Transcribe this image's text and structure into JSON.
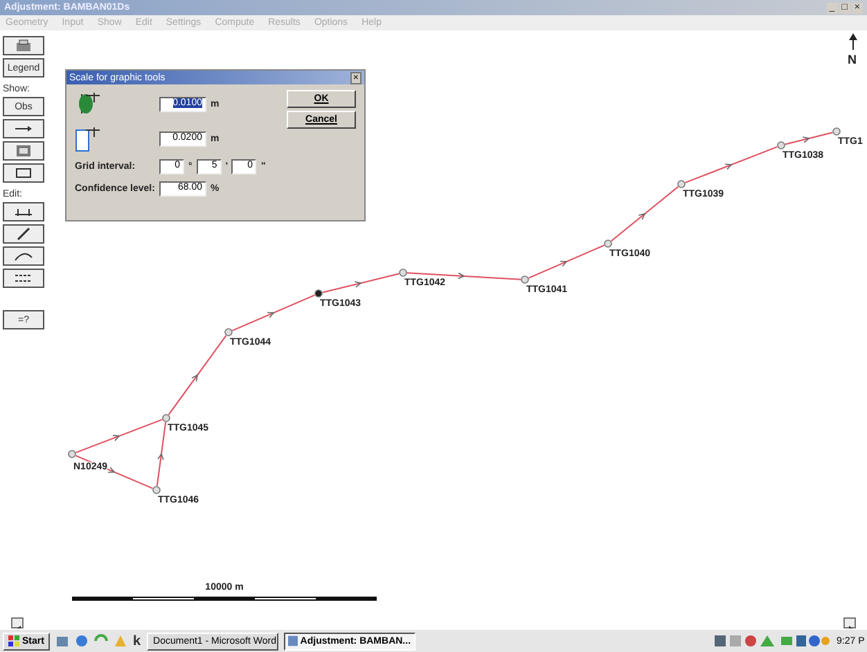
{
  "window": {
    "title": "Adjustment: BAMBAN01Ds",
    "controls": [
      "_",
      "□",
      "×"
    ]
  },
  "menu": [
    "Geometry",
    "Input",
    "Show",
    "Edit",
    "Settings",
    "Compute",
    "Results",
    "Options",
    "Help"
  ],
  "toolbar": [
    {
      "kind": "print"
    },
    {
      "kind": "text",
      "label": "Legend"
    },
    {
      "kind": "heading",
      "label": "Show:"
    },
    {
      "kind": "text",
      "label": "Obs"
    },
    {
      "kind": "arrow"
    },
    {
      "kind": "table"
    },
    {
      "kind": "frame"
    },
    {
      "kind": "heading",
      "label": "Edit:"
    },
    {
      "kind": "move"
    },
    {
      "kind": "pen"
    },
    {
      "kind": "curve"
    },
    {
      "kind": "dashes"
    },
    {
      "kind": "gap"
    },
    {
      "kind": "text",
      "label": "=?"
    }
  ],
  "dialog": {
    "title": "Scale for graphic tools",
    "ellipse_scale": {
      "value": "0.0100",
      "unit": "m",
      "selected": true
    },
    "rect_scale": {
      "value": "0.0200",
      "unit": "m",
      "selected": false
    },
    "grid_interval": {
      "label": "Grid interval:",
      "fields": [
        {
          "value": "0",
          "unit": "°"
        },
        {
          "value": "5",
          "unit": "'"
        },
        {
          "value": "0",
          "unit": "\""
        }
      ]
    },
    "confidence": {
      "label": "Confidence level:",
      "value": "68.00",
      "unit": "%"
    },
    "buttons": [
      "OK",
      "Cancel"
    ]
  },
  "network": {
    "stations": [
      {
        "name": "N10249",
        "selected": false
      },
      {
        "name": "TTG1046",
        "selected": false
      },
      {
        "name": "TTG1045",
        "selected": false
      },
      {
        "name": "TTG1044",
        "selected": false
      },
      {
        "name": "TTG1043",
        "selected": true
      },
      {
        "name": "TTG1042",
        "selected": false
      },
      {
        "name": "TTG1041",
        "selected": false
      },
      {
        "name": "TTG1040",
        "selected": false
      },
      {
        "name": "TTG1039",
        "selected": false
      },
      {
        "name": "TTG1038",
        "selected": false
      },
      {
        "name": "TTG1",
        "selected": false
      }
    ],
    "north_label": "N",
    "scale_label": "10000 m"
  },
  "taskbar": {
    "start": "Start",
    "quick_text": "k",
    "tasks": [
      {
        "label": "Document1 - Microsoft Word",
        "selected": false
      },
      {
        "label": "Adjustment: BAMBAN...",
        "selected": true
      }
    ],
    "clock": "9:27 P"
  }
}
